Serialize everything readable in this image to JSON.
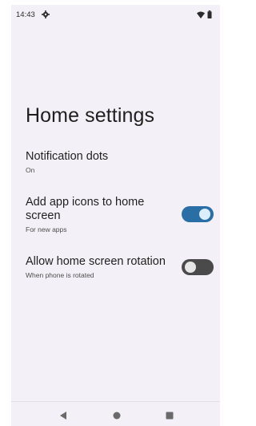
{
  "status_bar": {
    "time": "14:43",
    "left_icons": [
      "settings-gear-icon"
    ],
    "right_icons": [
      "wifi-icon",
      "battery-icon"
    ]
  },
  "page": {
    "title": "Home settings"
  },
  "settings": [
    {
      "title": "Notification dots",
      "subtitle": "On",
      "has_toggle": false
    },
    {
      "title": "Add app icons to home screen",
      "subtitle": "For new apps",
      "has_toggle": true,
      "toggle_state": "on"
    },
    {
      "title": "Allow home screen rotation",
      "subtitle": "When phone is rotated",
      "has_toggle": true,
      "toggle_state": "off"
    }
  ],
  "nav_bar": {
    "buttons": [
      "back-icon",
      "home-icon",
      "recents-icon"
    ]
  },
  "colors": {
    "background": "#f3f1f7",
    "toggle_on_track": "#2a6ea6",
    "toggle_off_track": "#4a4a4a"
  }
}
